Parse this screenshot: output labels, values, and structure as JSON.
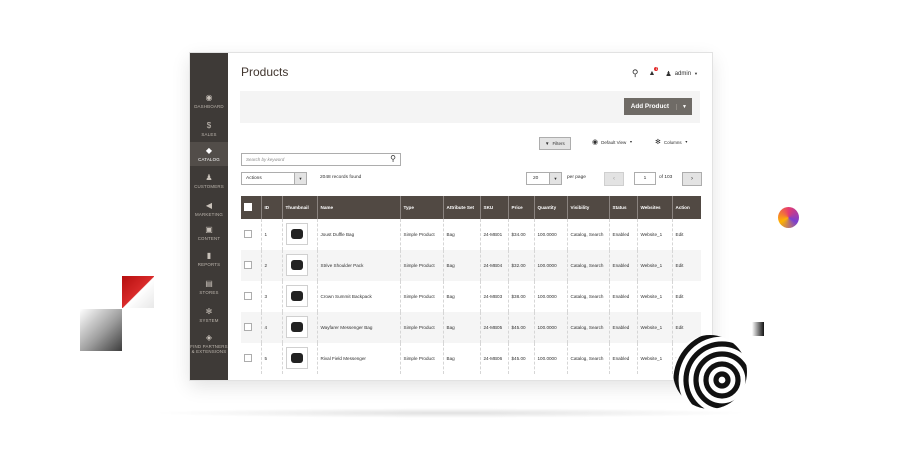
{
  "page": {
    "title": "Products"
  },
  "header": {
    "admin_label": "admin",
    "notification_count": "1"
  },
  "sidebar": {
    "items": [
      {
        "label": "DASHBOARD",
        "icon": "dashboard-icon",
        "glyph": "◉"
      },
      {
        "label": "SALES",
        "icon": "dollar-icon",
        "glyph": "$"
      },
      {
        "label": "CATALOG",
        "icon": "box-icon",
        "glyph": "◆"
      },
      {
        "label": "CUSTOMERS",
        "icon": "person-icon",
        "glyph": "♟"
      },
      {
        "label": "MARKETING",
        "icon": "megaphone-icon",
        "glyph": "◀"
      },
      {
        "label": "CONTENT",
        "icon": "layout-icon",
        "glyph": "▣"
      },
      {
        "label": "REPORTS",
        "icon": "bar-chart-icon",
        "glyph": "▮"
      },
      {
        "label": "STORES",
        "icon": "store-icon",
        "glyph": "▤"
      },
      {
        "label": "SYSTEM",
        "icon": "gear-icon",
        "glyph": "✻"
      },
      {
        "label": "FIND PARTNERS & EXTENSIONS",
        "icon": "blocks-icon",
        "glyph": "◈"
      }
    ]
  },
  "toolbar": {
    "add_product_label": "Add Product",
    "filters_label": "Filters",
    "default_view_label": "Default View",
    "columns_label": "Columns",
    "search_placeholder": "Search by keyword",
    "actions_label": "Actions",
    "records_found": "2048 records found",
    "per_page_value": "20",
    "per_page_label": "per page",
    "page_current": "1",
    "page_total": "of 103"
  },
  "grid": {
    "columns": [
      "ID",
      "Thumbnail",
      "Name",
      "Type",
      "Attribute Set",
      "SKU",
      "Price",
      "Quantity",
      "Visibility",
      "Status",
      "Websites",
      "Action"
    ],
    "rows": [
      {
        "id": "1",
        "name": "Joust Duffle Bag",
        "type": "Simple Product",
        "attr": "Bag",
        "sku": "24-MB01",
        "price": "$34.00",
        "qty": "100.0000",
        "visibility": "Catalog, Search",
        "status": "Enabled",
        "websites": "Website_1",
        "action": "Edit"
      },
      {
        "id": "2",
        "name": "Strive Shoulder Pack",
        "type": "Simple Product",
        "attr": "Bag",
        "sku": "24-MB04",
        "price": "$32.00",
        "qty": "100.0000",
        "visibility": "Catalog, Search",
        "status": "Enabled",
        "websites": "Website_1",
        "action": "Edit"
      },
      {
        "id": "3",
        "name": "Crown Summit Backpack",
        "type": "Simple Product",
        "attr": "Bag",
        "sku": "24-MB03",
        "price": "$38.00",
        "qty": "100.0000",
        "visibility": "Catalog, Search",
        "status": "Enabled",
        "websites": "Website_1",
        "action": "Edit"
      },
      {
        "id": "4",
        "name": "Wayfarer Messenger Bag",
        "type": "Simple Product",
        "attr": "Bag",
        "sku": "24-MB05",
        "price": "$45.00",
        "qty": "100.0000",
        "visibility": "Catalog, Search",
        "status": "Enabled",
        "websites": "Website_1",
        "action": "Edit"
      },
      {
        "id": "5",
        "name": "Rival Field Messenger",
        "type": "Simple Product",
        "attr": "Bag",
        "sku": "24-MB06",
        "price": "$45.00",
        "qty": "100.0000",
        "visibility": "Catalog, Search",
        "status": "Enabled",
        "websites": "Website_1",
        "action": "Edit"
      }
    ]
  },
  "colors": {
    "sidebar_bg": "#3e3a37",
    "grid_header_bg": "#514943",
    "primary_button": "#6f6b66",
    "link": "#007bdb",
    "badge": "#e22626"
  }
}
